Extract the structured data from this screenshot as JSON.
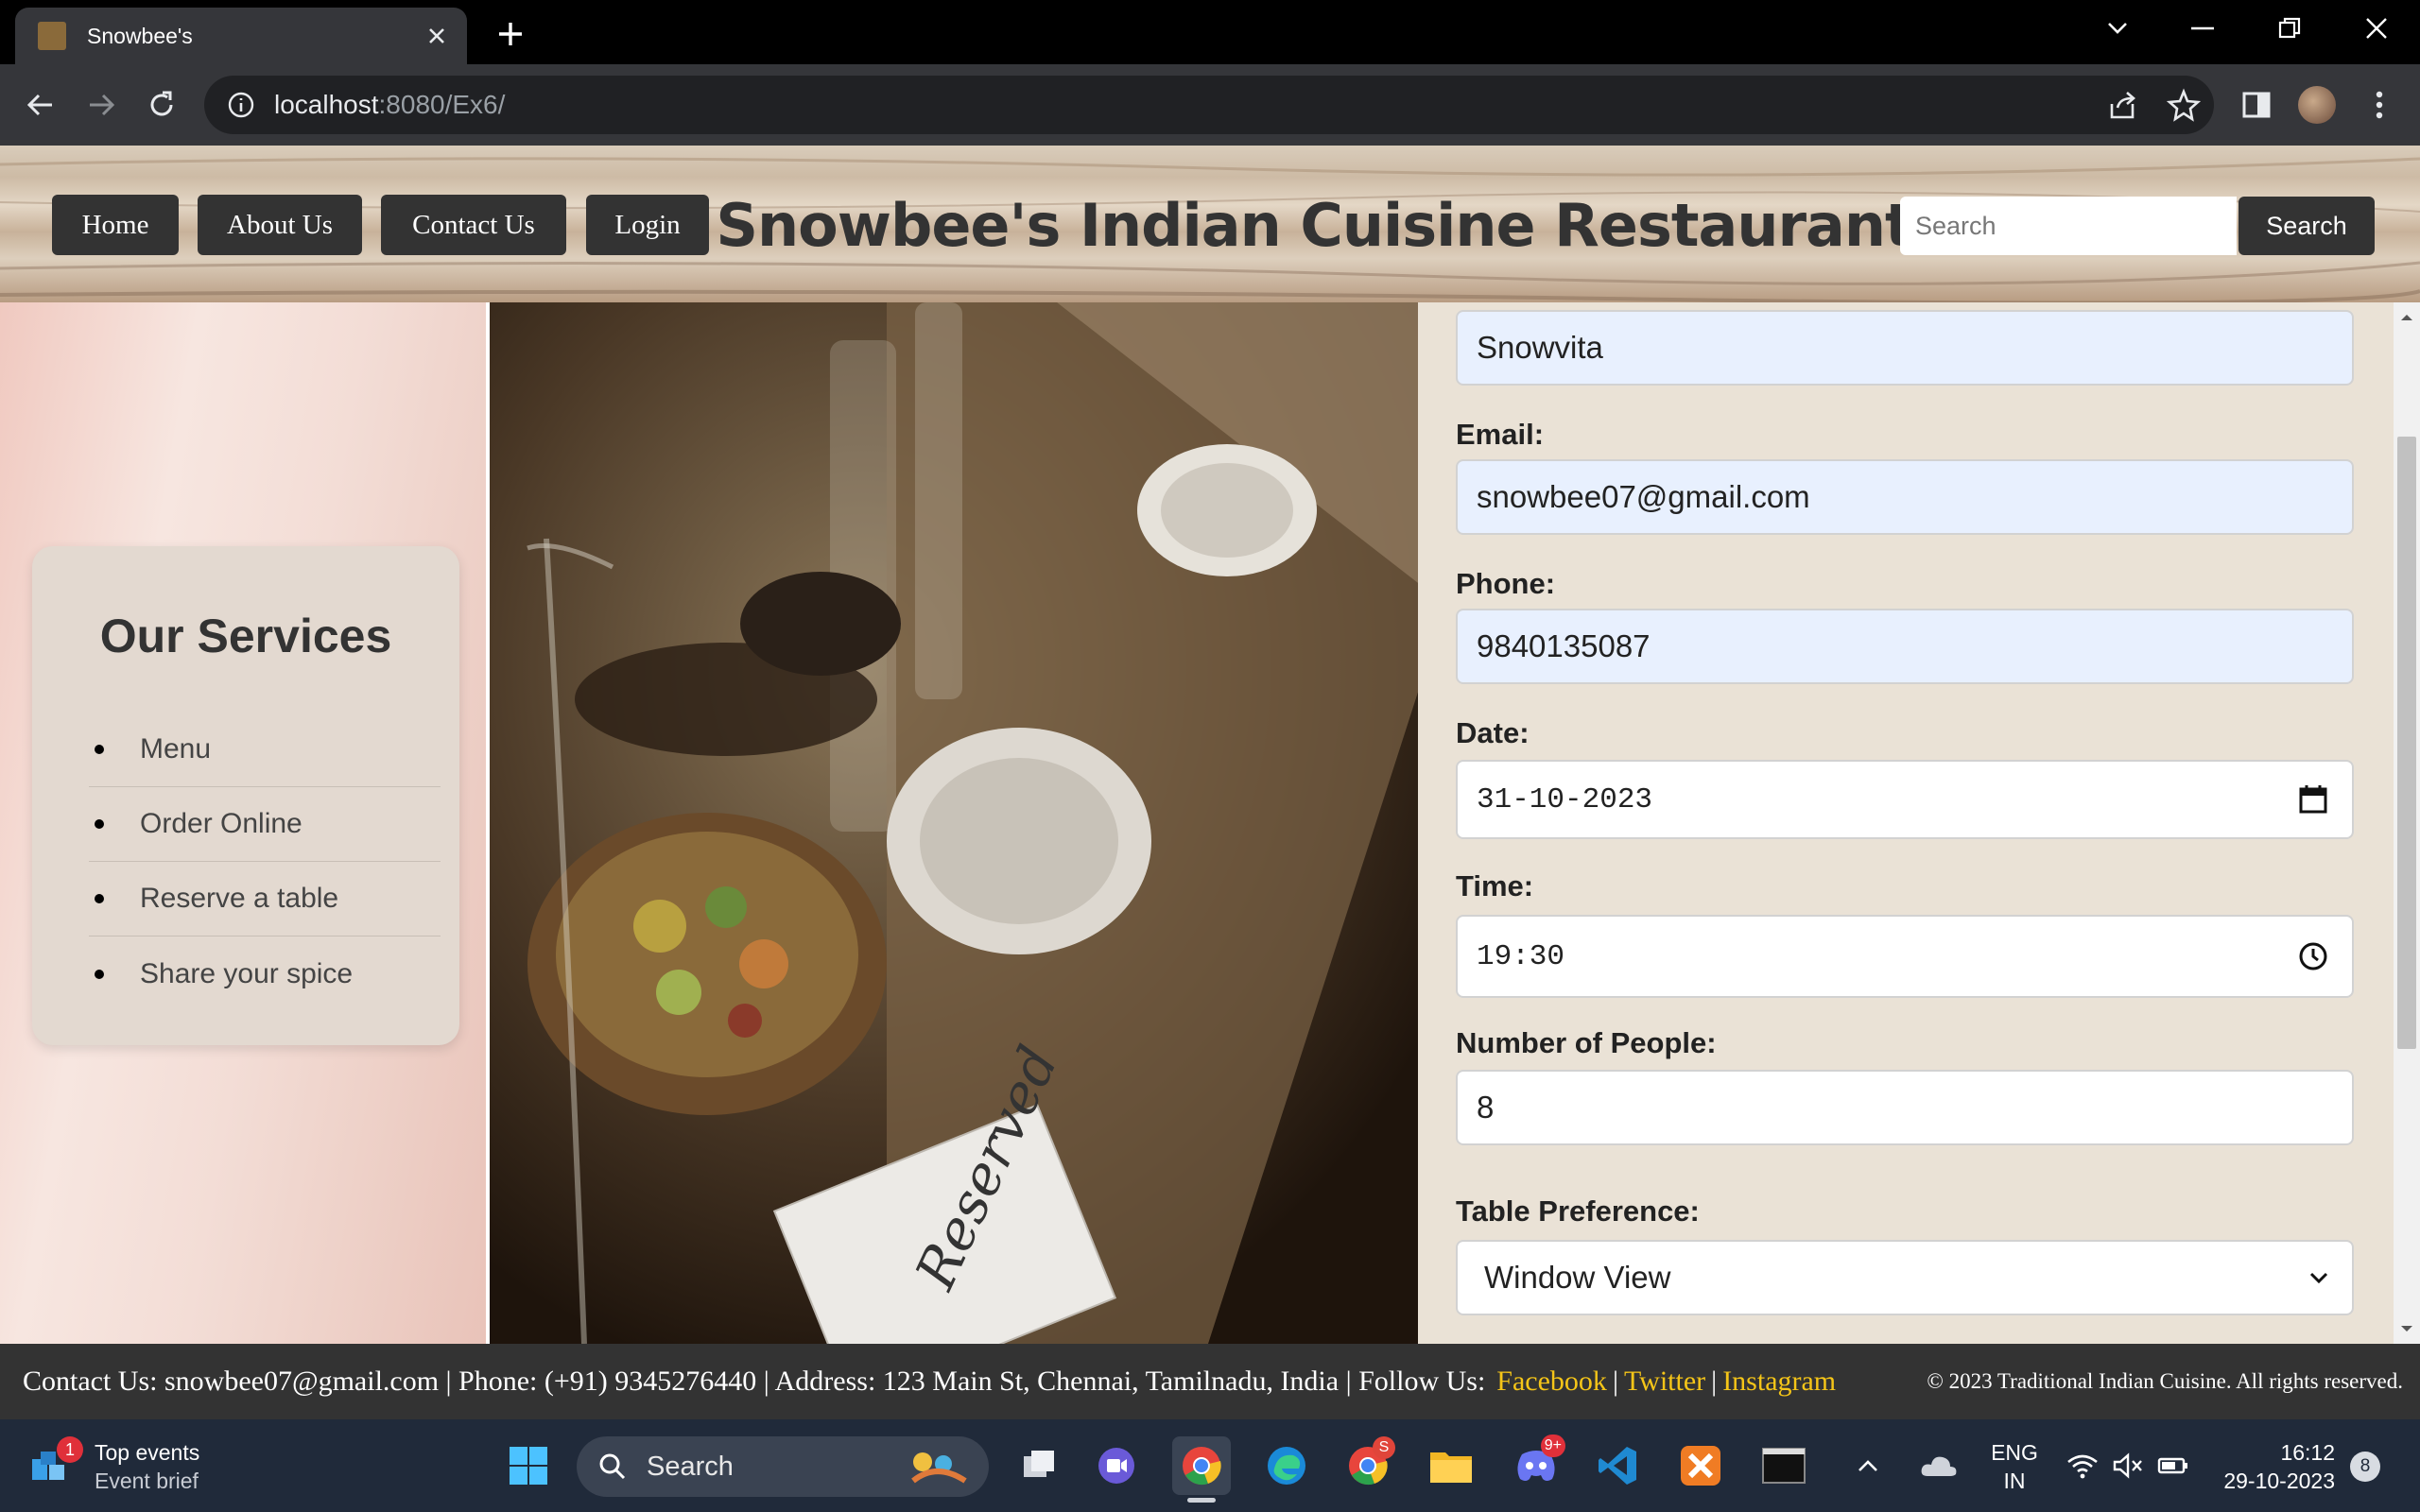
{
  "browser": {
    "tab_title": "Snowbee's",
    "url_host": "localhost",
    "url_path": ":8080/Ex6/"
  },
  "header": {
    "nav": [
      "Home",
      "About Us",
      "Contact Us",
      "Login"
    ],
    "title": "Snowbee's Indian Cuisine Restaurant",
    "search_placeholder": "Search",
    "search_button": "Search"
  },
  "services": {
    "heading": "Our Services",
    "items": [
      "Menu",
      "Order Online",
      "Reserve a table",
      "Share your spice"
    ]
  },
  "photo": {
    "sign_text": "Reserved"
  },
  "form": {
    "name_value": "Snowvita",
    "email_label": "Email:",
    "email_value": "snowbee07@gmail.com",
    "phone_label": "Phone:",
    "phone_value": "9840135087",
    "date_label": "Date:",
    "date_value": "31-10-2023",
    "time_label": "Time:",
    "time_value": "19:30",
    "people_label": "Number of People:",
    "people_value": "8",
    "table_label": "Table Preference:",
    "table_value": "Window View"
  },
  "footer": {
    "contact": "Contact Us: snowbee07@gmail.com | Phone: (+91) 9345276440 | Address: 123 Main St, Chennai, Tamilnadu, India | Follow Us:",
    "facebook": "Facebook",
    "twitter": "Twitter",
    "instagram": "Instagram",
    "copyright": "© 2023 Traditional Indian Cuisine. All rights reserved."
  },
  "taskbar": {
    "widget_badge": "1",
    "widget_title": "Top events",
    "widget_sub": "Event brief",
    "search": "Search",
    "lang1": "ENG",
    "lang2": "IN",
    "time": "16:12",
    "date": "29-10-2023",
    "notif_count": "8",
    "discord_badge": "9+",
    "chrome2_badge": "S"
  },
  "colors": {
    "header_button": "#333333",
    "link_yellow": "#f5c518",
    "autofill": "#e8f0fe",
    "page_bg": "#eae2d6"
  }
}
